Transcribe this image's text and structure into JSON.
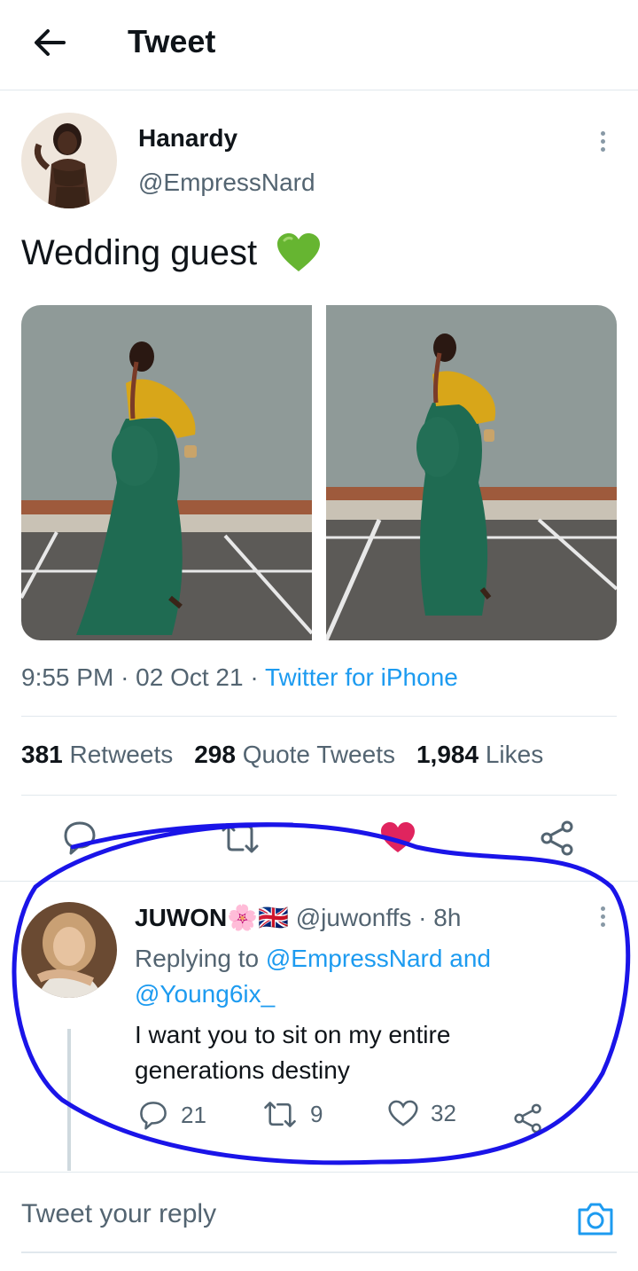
{
  "header": {
    "title": "Tweet",
    "back_icon": "arrow-left-icon"
  },
  "tweet": {
    "author_name": "Hanardy",
    "author_handle": "@EmpressNard",
    "text": "Wedding guest",
    "emoji": "green-heart-emoji",
    "time": "9:55 PM",
    "date": "02 Oct 21",
    "source": "Twitter for iPhone",
    "retweets_count": "381",
    "retweets_label": "Retweets",
    "quote_count": "298",
    "quote_label": "Quote Tweets",
    "likes_count": "1,984",
    "likes_label": "Likes",
    "liked": true,
    "like_color": "#e0245e"
  },
  "reply": {
    "name": "JUWON🌸🇬🇧",
    "handle": "@juwonffs",
    "age": "8h",
    "replying_prefix": "Replying to",
    "replying_to_1": "@EmpressNard",
    "replying_and": "and",
    "replying_to_2": "@Young6ix_",
    "text": "I want you to sit on my entire generations destiny",
    "reply_count": "21",
    "retweet_count": "9",
    "like_count": "32"
  },
  "composer": {
    "placeholder": "Tweet your reply",
    "camera_icon": "camera-icon"
  },
  "colors": {
    "accent": "#1d9bf0",
    "muted": "#536471",
    "annotation": "#1a14e8"
  }
}
